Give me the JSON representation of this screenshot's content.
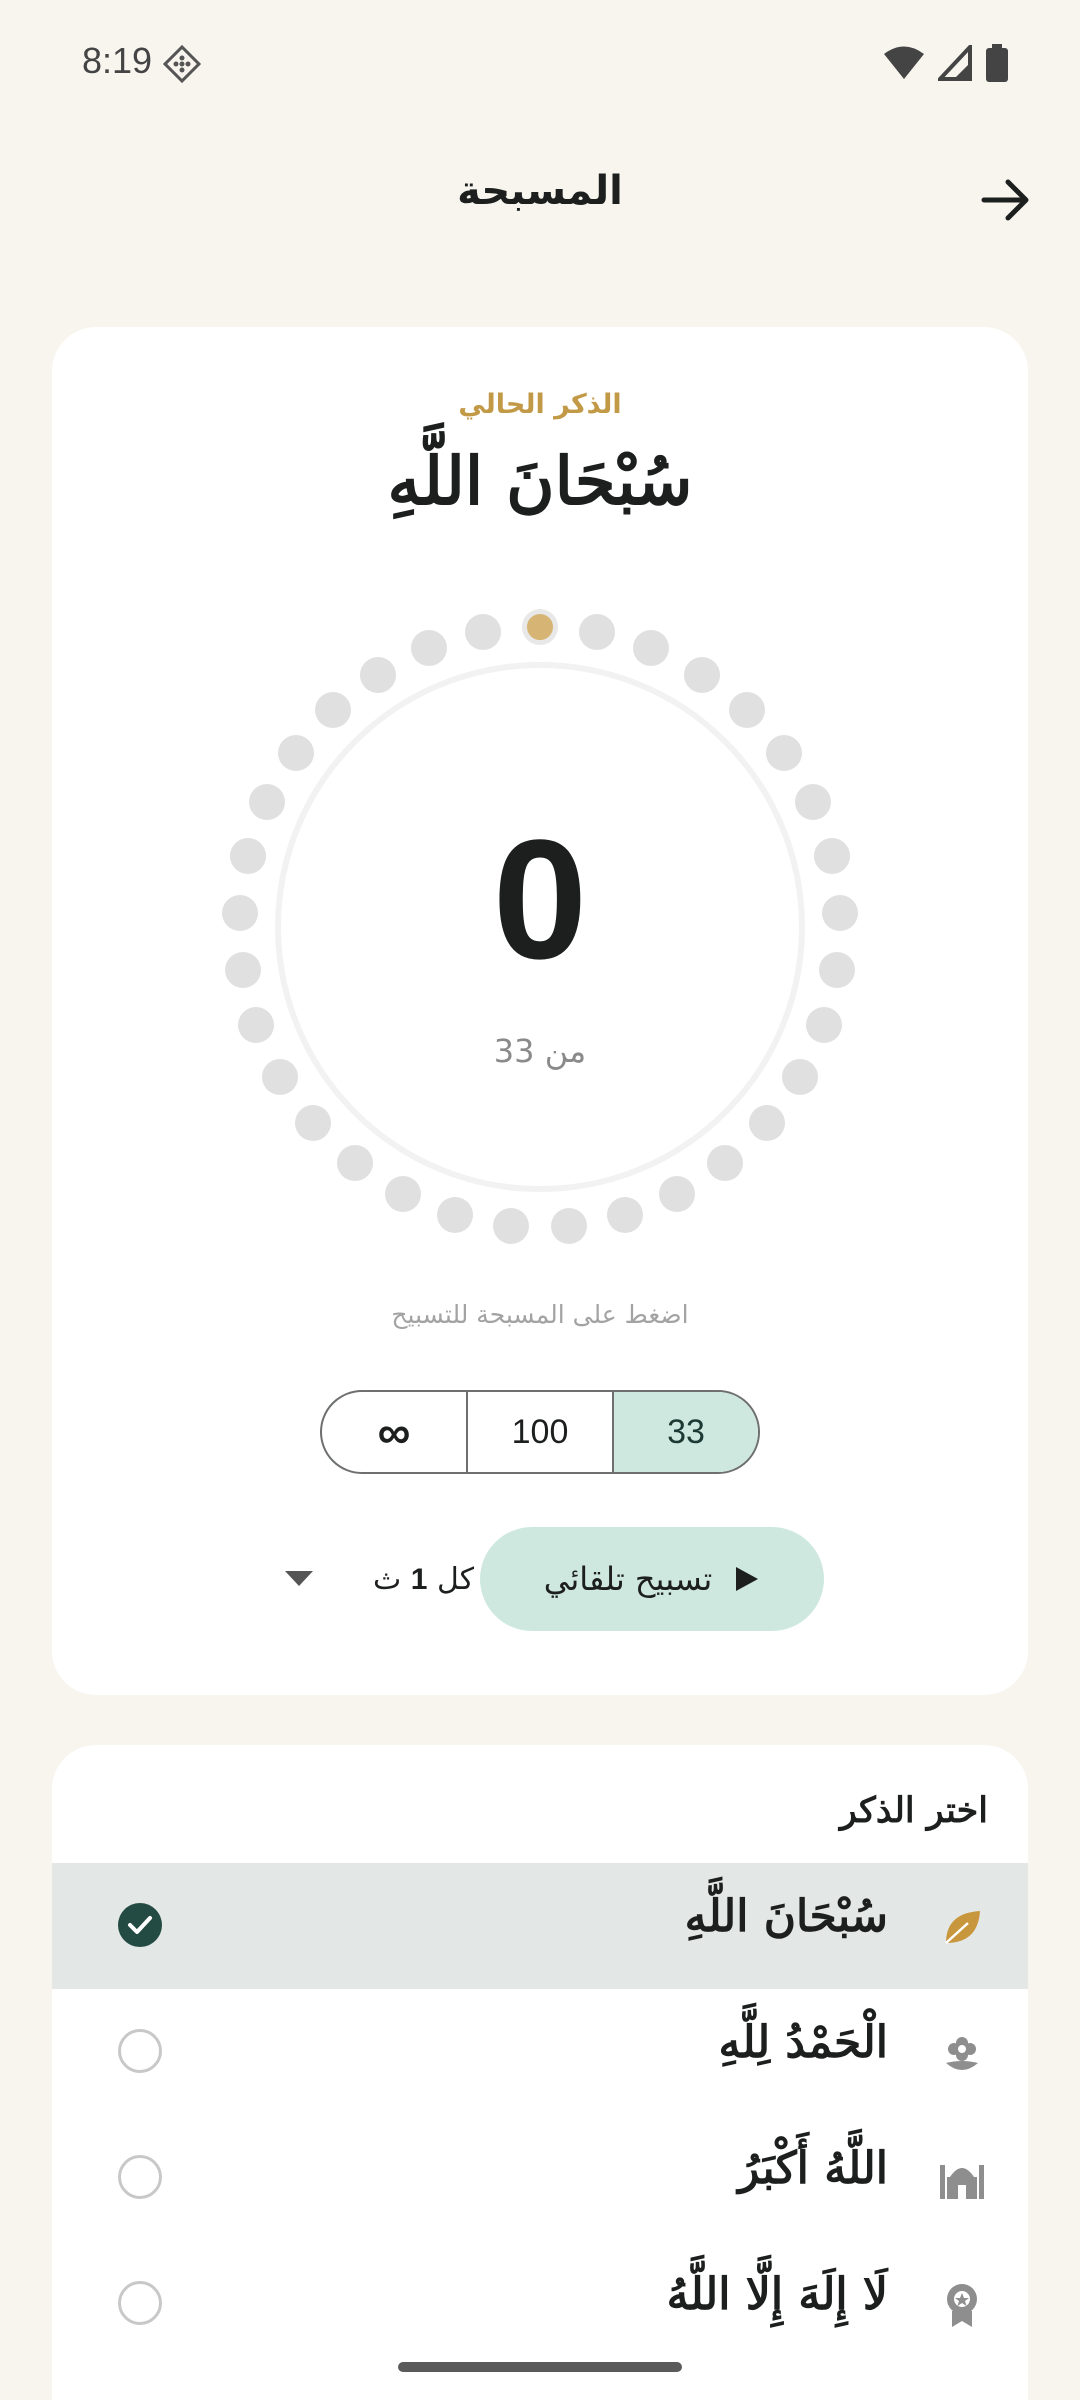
{
  "status_bar": {
    "time": "8:19",
    "left_icon": "diamond-pattern-icon",
    "right_icons": [
      "wifi-icon",
      "signal-icon",
      "battery-icon"
    ]
  },
  "app_bar": {
    "title": "المسبحة",
    "back_icon": "arrow-right-icon"
  },
  "counter": {
    "caption": "الذكر الحالي",
    "current_dhikr": "سُبْحَانَ اللَّهِ",
    "count": "0",
    "target_text": "من 33",
    "progress": 0,
    "beads_total": 33,
    "tap_hint": "اضغط على المسبحة للتسبيح",
    "target_options": [
      {
        "label": "33",
        "selected": true
      },
      {
        "label": "100",
        "selected": false
      },
      {
        "label": "∞",
        "selected": false
      }
    ],
    "auto_button_label": "تسبيح تلقائي",
    "interval_prefix": "كل",
    "interval_value": "1",
    "interval_unit": "ث"
  },
  "dhikr_list": {
    "title": "اختر الذكر",
    "items": [
      {
        "text": "سُبْحَانَ اللَّهِ",
        "icon": "leaf-icon",
        "selected": true
      },
      {
        "text": "الْحَمْدُ لِلَّهِ",
        "icon": "flower-icon",
        "selected": false
      },
      {
        "text": "اللَّهُ أَكْبَرُ",
        "icon": "mosque-icon",
        "selected": false
      },
      {
        "text": "لَا إِلَهَ إِلَّا اللَّهُ",
        "icon": "medal-icon",
        "selected": false
      }
    ]
  },
  "colors": {
    "background": "#f8f5ef",
    "accent_gold": "#c29a47",
    "accent_mint": "#cfe8df",
    "check_dark": "#244b43",
    "text_primary": "#1c1f1e"
  }
}
